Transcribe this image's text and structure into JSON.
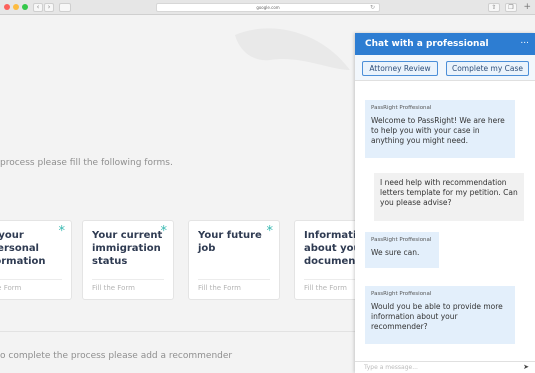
{
  "browser": {
    "url": "google.com",
    "back_glyph": "‹",
    "forward_glyph": "›",
    "reload_glyph": "↻",
    "share_glyph": "⇧",
    "tabs_glyph": "❐",
    "plus_glyph": "+"
  },
  "main": {
    "instruction": "process please fill the following forms.",
    "cards": [
      {
        "title": "r your personal formation",
        "link": "the Form",
        "required": true
      },
      {
        "title": "Your current immigration status",
        "link": "Fill the Form",
        "required": true
      },
      {
        "title": "Your future job",
        "link": "Fill the Form",
        "required": true
      },
      {
        "title": "Information about your documents",
        "link": "Fill the Form",
        "required": false
      }
    ],
    "required_glyph": "*",
    "recommender_prompt": "o complete the process please add a recommender"
  },
  "chat": {
    "title": "Chat with a professional",
    "minimize": "...",
    "buttons": [
      "Attorney Review",
      "Complete my Case"
    ],
    "messages": [
      {
        "from": "pro",
        "sender": "PassRight Proffesional",
        "text": "Welcome to PassRight! We are here to help you with your case in anything you might need."
      },
      {
        "from": "user",
        "sender": "",
        "text": "I need help with recommendation letters template for my petition. Can you please advise?"
      },
      {
        "from": "pro",
        "sender": "PassRight Proffesional",
        "text": "We sure can."
      },
      {
        "from": "pro",
        "sender": "PassRight Proffesional",
        "text": "Would you be able to provide more information about your recommender?"
      }
    ],
    "input_placeholder": "Type a message...",
    "send_glyph": "➤"
  },
  "colors": {
    "chat_header": "#2d7dd2",
    "required_star": "#35b8b0",
    "pro_bubble": "#e3effb",
    "user_bubble": "#f1f1f1"
  }
}
